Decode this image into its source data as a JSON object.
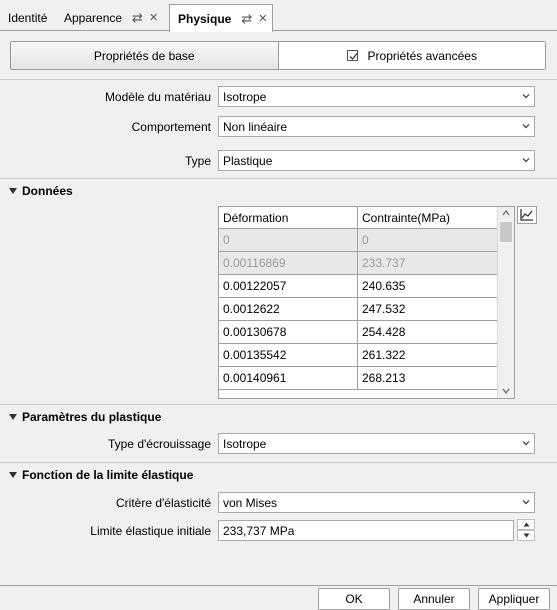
{
  "tabs": [
    {
      "label": "Identité"
    },
    {
      "label": "Apparence"
    },
    {
      "label": "Physique"
    }
  ],
  "toggle": {
    "basic_label": "Propriétés de base",
    "advanced_label": "Propriétés avancées",
    "advanced_checked": true
  },
  "form": {
    "material_model_label": "Modèle du matériau",
    "material_model_value": "Isotrope",
    "behavior_label": "Comportement",
    "behavior_value": "Non linéaire",
    "type_label": "Type",
    "type_value": "Plastique"
  },
  "data_section": {
    "title": "Données",
    "columns": [
      "Déformation",
      "Contrainte(MPa)"
    ],
    "rows": [
      [
        "0",
        "0"
      ],
      [
        "0.00116869",
        "233.737"
      ],
      [
        "0.00122057",
        "240.635"
      ],
      [
        "0.0012622",
        "247.532"
      ],
      [
        "0.00130678",
        "254.428"
      ],
      [
        "0.00135542",
        "261.322"
      ],
      [
        "0.00140961",
        "268.213"
      ]
    ]
  },
  "plastic_section": {
    "title": "Paramètres du plastique",
    "hardening_label": "Type d'écrouissage",
    "hardening_value": "Isotrope"
  },
  "yield_section": {
    "title": "Fonction de la limite élastique",
    "criterion_label": "Critère d'élasticité",
    "criterion_value": "von Mises",
    "initial_limit_label": "Limite élastique initiale",
    "initial_limit_value": "233,737 MPa"
  },
  "buttons": {
    "ok": "OK",
    "cancel": "Annuler",
    "apply": "Appliquer"
  }
}
